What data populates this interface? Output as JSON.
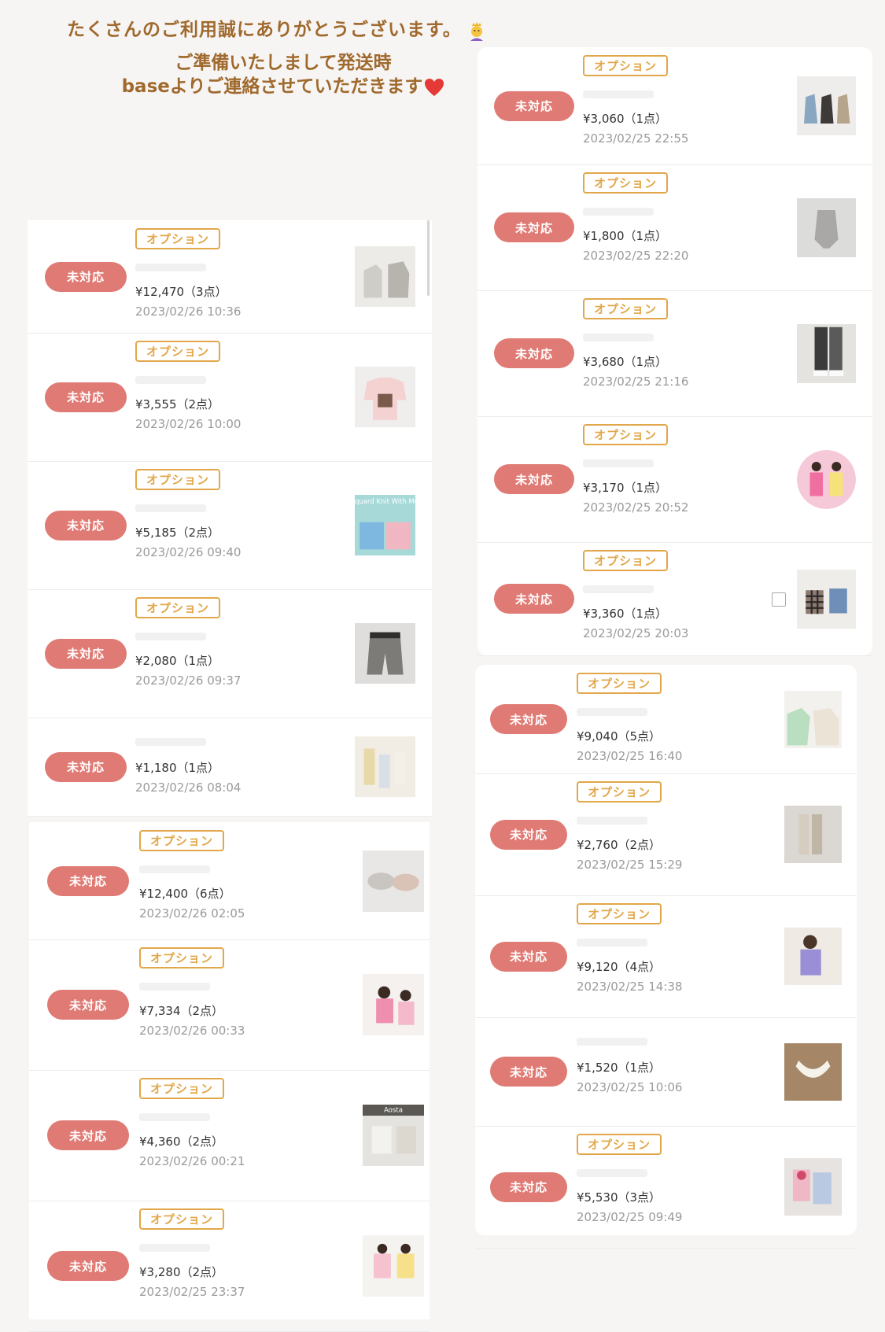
{
  "header": {
    "line1": "たくさんのご利用誠にありがとうございます。",
    "line2": "ご準備いたしまして発送時",
    "line3": "baseよりご連絡させていただきます"
  },
  "labels": {
    "status": "未対応",
    "option": "オプション"
  },
  "colors": {
    "status_bg": "#e07a74",
    "option": "#e2a74a",
    "header_text": "#a0692d"
  },
  "left_orders": [
    {
      "price": "¥12,470（3点）",
      "date": "2023/02/26 10:36",
      "option": true,
      "thumb": "clothes-gray"
    },
    {
      "price": "¥3,555（2点）",
      "date": "2023/02/26 10:00",
      "option": true,
      "thumb": "sweatshirt-pink"
    },
    {
      "price": "¥5,185（2点）",
      "date": "2023/02/26 09:40",
      "option": true,
      "thumb": "knit-teal",
      "thumb_text": "Jacquard Knit With Mom"
    },
    {
      "price": "¥2,080（1点）",
      "date": "2023/02/26 09:37",
      "option": true,
      "thumb": "shorts-gray"
    },
    {
      "price": "¥1,180（1点）",
      "date": "2023/02/26 08:04",
      "option": false,
      "thumb": "socks-beige"
    },
    {
      "price": "¥12,400（6点）",
      "date": "2023/02/26 02:05",
      "option": true,
      "thumb": "hats-gray"
    },
    {
      "price": "¥7,334（2点）",
      "date": "2023/02/26 00:33",
      "option": true,
      "thumb": "kids-pink"
    },
    {
      "price": "¥4,360（2点）",
      "date": "2023/02/26 00:21",
      "option": true,
      "thumb": "skirts-white",
      "thumb_text": "Aosta"
    },
    {
      "price": "¥3,280（2点）",
      "date": "2023/02/25 23:37",
      "option": true,
      "thumb": "kids-colorful"
    }
  ],
  "right_orders": [
    {
      "price": "¥3,060（1点）",
      "date": "2023/02/25 22:55",
      "option": true,
      "thumb": "dresses-blue"
    },
    {
      "price": "¥1,800（1点）",
      "date": "2023/02/25 22:20",
      "option": true,
      "thumb": "bodysuit-gray"
    },
    {
      "price": "¥3,680（1点）",
      "date": "2023/02/25 21:16",
      "option": true,
      "thumb": "pants-dark"
    },
    {
      "price": "¥3,170（1点）",
      "date": "2023/02/25 20:52",
      "option": true,
      "thumb": "girls-pink-circle"
    },
    {
      "price": "¥3,360（1点）",
      "date": "2023/02/25 20:03",
      "option": true,
      "thumb": "check-jackets",
      "memo": true
    },
    {
      "price": "¥9,040（5点）",
      "date": "2023/02/25 16:40",
      "option": true,
      "thumb": "sweater-green"
    },
    {
      "price": "¥2,760（2点）",
      "date": "2023/02/25 15:29",
      "option": true,
      "thumb": "leggings-beige"
    },
    {
      "price": "¥9,120（4点）",
      "date": "2023/02/25 14:38",
      "option": true,
      "thumb": "child-purple"
    },
    {
      "price": "¥1,520（1点）",
      "date": "2023/02/25 10:06",
      "option": false,
      "thumb": "lace-collar"
    },
    {
      "price": "¥5,530（3点）",
      "date": "2023/02/25 09:49",
      "option": true,
      "thumb": "clothes-pastel"
    }
  ]
}
